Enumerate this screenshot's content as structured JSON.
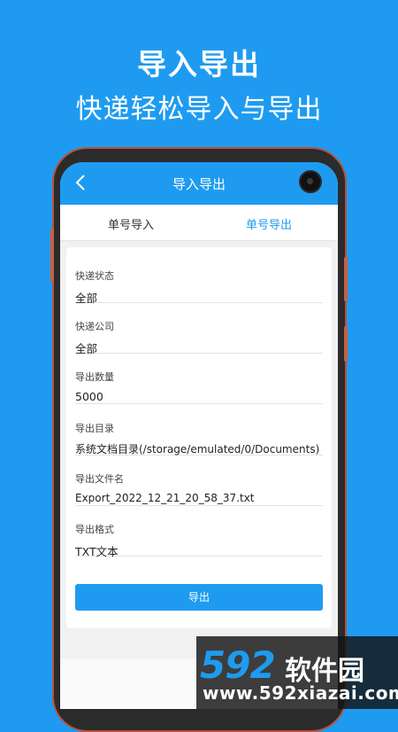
{
  "promo": {
    "title": "导入导出",
    "subtitle": "快递轻松导入与导出"
  },
  "appbar": {
    "back_icon": "chevron-left-icon",
    "title": "导入导出"
  },
  "tabs": [
    {
      "label": "单号导入",
      "active": false
    },
    {
      "label": "单号导出",
      "active": true
    }
  ],
  "form": {
    "fields": [
      {
        "label": "快递状态",
        "value": "全部"
      },
      {
        "label": "快递公司",
        "value": "全部"
      },
      {
        "label": "导出数量",
        "value": "5000"
      },
      {
        "label": "导出目录",
        "value": "系统文档目录(/storage/emulated/0/Documents)"
      },
      {
        "label": "导出文件名",
        "value": "Export_2022_12_21_20_58_37.txt"
      },
      {
        "label": "导出格式",
        "value": "TXT文本"
      }
    ],
    "export_button": "导出"
  },
  "watermark": {
    "number": "592",
    "brand": "软件园",
    "url": "www.592xiazai.com"
  },
  "colors": {
    "accent": "#1e9bf0",
    "phone_frame": "#c9603f"
  }
}
